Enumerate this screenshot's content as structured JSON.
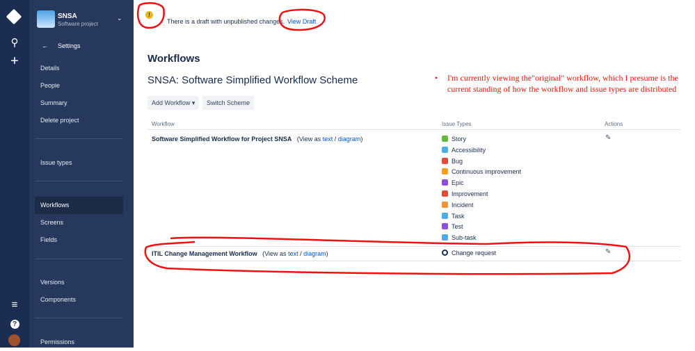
{
  "global_nav": {
    "icons": [
      "jira-logo-icon",
      "search-icon",
      "create-icon",
      "menu-icon",
      "help-icon",
      "avatar"
    ]
  },
  "project": {
    "name": "SNSA",
    "type": "Software project"
  },
  "sidebar": {
    "back_label": "Settings",
    "items": [
      {
        "label": "Details"
      },
      {
        "label": "People"
      },
      {
        "label": "Summary"
      },
      {
        "label": "Delete project"
      },
      {
        "label": "Issue types"
      },
      {
        "label": "Workflows"
      },
      {
        "label": "Screens"
      },
      {
        "label": "Fields"
      },
      {
        "label": "Versions"
      },
      {
        "label": "Components"
      },
      {
        "label": "Permissions"
      }
    ]
  },
  "draft_banner": {
    "text": "There is a draft with unpublished changes.",
    "link": "View Draft"
  },
  "page": {
    "title": "Workflows",
    "scheme": "SNSA: Software Simplified Workflow Scheme",
    "add_workflow": "Add Workflow",
    "switch_scheme": "Switch Scheme"
  },
  "table": {
    "headers": [
      "Workflow",
      "Issue Types",
      "Actions"
    ],
    "rows": [
      {
        "name": "Software Simplified Workflow for Project SNSA",
        "view_as": "(View as",
        "text": "text",
        "slash": "/",
        "diagram": "diagram",
        "close": ")",
        "issue_types": [
          {
            "label": "Story",
            "color": "#63ba3c"
          },
          {
            "label": "Accessibility",
            "color": "#4bade8"
          },
          {
            "label": "Bug",
            "color": "#e5493a"
          },
          {
            "label": "Continuous improvement",
            "color": "#ff9f1a"
          },
          {
            "label": "Epic",
            "color": "#904ee2"
          },
          {
            "label": "Improvement",
            "color": "#e5493a"
          },
          {
            "label": "Incident",
            "color": "#f79232"
          },
          {
            "label": "Task",
            "color": "#4bade8"
          },
          {
            "label": "Test",
            "color": "#904ee2"
          },
          {
            "label": "Sub-task",
            "color": "#4bade8"
          }
        ]
      },
      {
        "name": "ITIL Change Management Workflow",
        "view_as": "(View as",
        "text": "text",
        "slash": "/",
        "diagram": "diagram",
        "close": ")",
        "issue_types": [
          {
            "label": "Change request",
            "color": "#172b4d"
          }
        ]
      }
    ]
  },
  "annotation": {
    "bullet": "•",
    "line1": "I'm currently viewing the\"original\" workflow, which I presume is the",
    "line2": "current standing of how the workflow and issue types are distributed"
  }
}
